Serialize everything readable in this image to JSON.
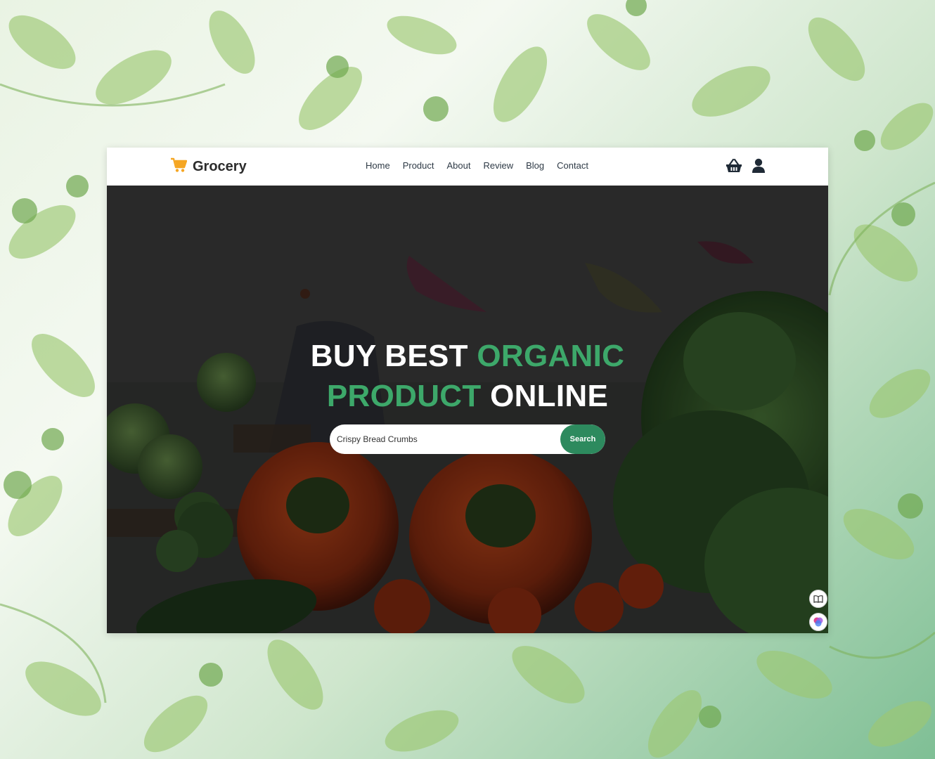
{
  "brand": {
    "name": "Grocery",
    "icon": "shopping-cart-icon",
    "icon_color": "#f5a623"
  },
  "nav": {
    "items": [
      {
        "label": "Home"
      },
      {
        "label": "Product"
      },
      {
        "label": "About"
      },
      {
        "label": "Review"
      },
      {
        "label": "Blog"
      },
      {
        "label": "Contact"
      }
    ]
  },
  "header_icons": {
    "basket": "basket-icon",
    "user": "user-icon"
  },
  "hero": {
    "line1_white": "BUY BEST ",
    "line1_green": "ORGANIC",
    "line2_green": "PRODUCT",
    "line2_white": " ONLINE",
    "accent_color": "#3da86a"
  },
  "search": {
    "value": "Crispy Bread Crumbs",
    "button_label": "Search",
    "button_color": "#2d8a5e"
  },
  "widgets": [
    "book-icon",
    "assistant-orb-icon"
  ]
}
